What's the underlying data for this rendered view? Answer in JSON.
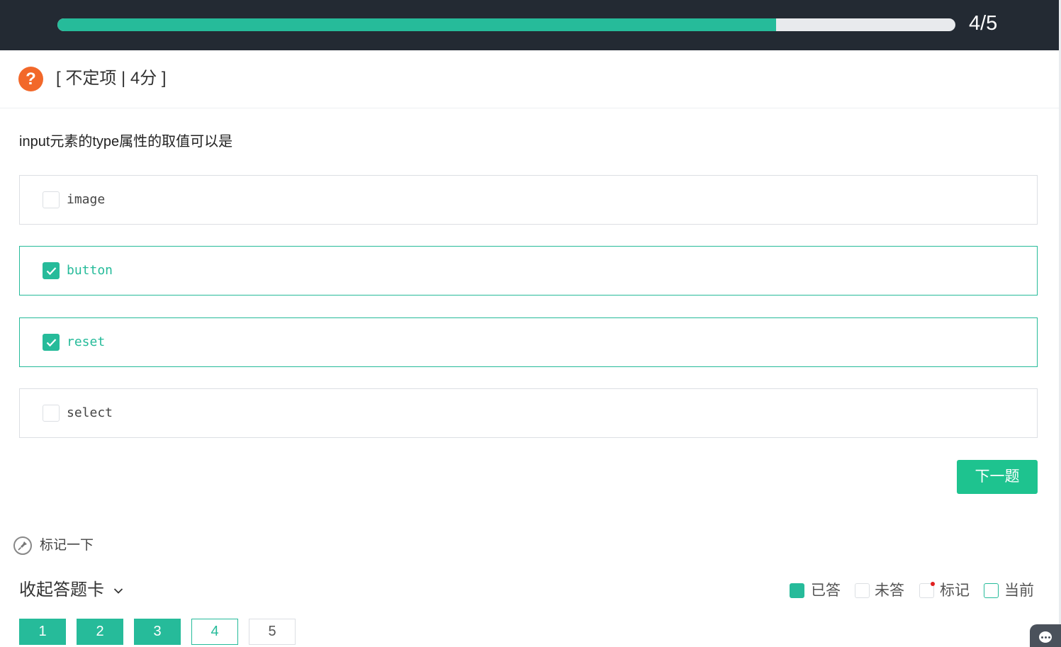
{
  "progress": {
    "text": "4/5",
    "fraction": 0.8
  },
  "question": {
    "type_label": "[ 不定项 | 4分 ]",
    "icon": "question-mark-icon",
    "icon_glyph": "?",
    "stem": "input元素的type属性的取值可以是"
  },
  "options": [
    {
      "label": "image",
      "checked": false
    },
    {
      "label": "button",
      "checked": true
    },
    {
      "label": "reset",
      "checked": true
    },
    {
      "label": "select",
      "checked": false
    }
  ],
  "next_button": "下一题",
  "mark": {
    "label": "标记一下",
    "icon": "pin-icon"
  },
  "answer_card": {
    "collapse_label": "收起答题卡",
    "legend": {
      "answered": "已答",
      "unanswered": "未答",
      "marked": "标记",
      "current": "当前"
    },
    "numbers": [
      {
        "label": "1",
        "state": "answered"
      },
      {
        "label": "2",
        "state": "answered"
      },
      {
        "label": "3",
        "state": "answered"
      },
      {
        "label": "4",
        "state": "current"
      },
      {
        "label": "5",
        "state": "unanswered"
      }
    ]
  },
  "colors": {
    "accent": "#26bb9a",
    "button": "#1ec38f",
    "topbar": "#232a33",
    "question_icon": "#f2682a",
    "mark_dot": "#e02020"
  },
  "chat": {
    "icon": "chat-icon"
  }
}
